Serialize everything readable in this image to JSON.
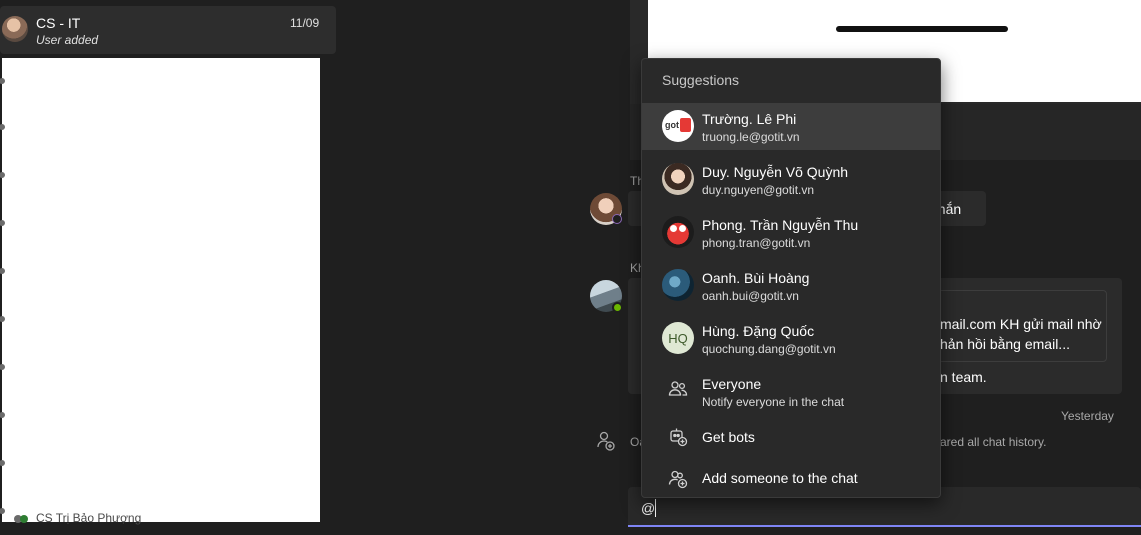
{
  "chat_list": {
    "active_chat": {
      "title": "CS - IT",
      "subtitle": "User added",
      "date": "11/09"
    },
    "bottom_peek": "CS Trị Bảo Phượng"
  },
  "conversation": {
    "name_fragment_1": "Th",
    "name_fragment_2": "Kh",
    "bubble1_fragment": "nhắn",
    "quote_line1": "mail.com KH gửi mail nhờ",
    "quote_line2": "hản hồi bằng email...",
    "bubble2_fragment": "n team.",
    "yesterday_label": "Yesterday",
    "system_left_fragment": "Oa",
    "system_right_fragment": "ared all chat history."
  },
  "compose": {
    "value": "@"
  },
  "suggestions": {
    "header": "Suggestions",
    "items": [
      {
        "name": "Trường. Lê Phi",
        "email": "truong.le@gotit.vn",
        "highlighted": true,
        "avatar_text": "got"
      },
      {
        "name": "Duy. Nguyễn Võ Quỳnh",
        "email": "duy.nguyen@gotit.vn"
      },
      {
        "name": "Phong. Trần Nguyễn Thu",
        "email": "phong.tran@gotit.vn"
      },
      {
        "name": "Oanh. Bùi Hoàng",
        "email": "oanh.bui@gotit.vn"
      },
      {
        "name": "Hùng. Đặng Quốc",
        "email": "quochung.dang@gotit.vn",
        "initials": "HQ"
      },
      {
        "name": "Everyone",
        "email": "Notify everyone in the chat",
        "icon": "people-icon"
      },
      {
        "name": "Get bots",
        "icon": "bot-add-icon"
      },
      {
        "name": "Add someone to the chat",
        "icon": "person-add-icon"
      }
    ]
  },
  "colors": {
    "accent": "#7f85f5",
    "background": "#1f1f1f",
    "popup": "#292929",
    "highlight": "#3d3d3d",
    "online": "#6bb700"
  }
}
